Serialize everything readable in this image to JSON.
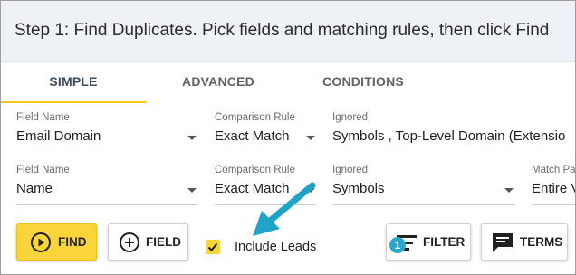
{
  "header": {
    "title": "Step 1: Find Duplicates. Pick fields and matching rules, then click Find"
  },
  "tabs": [
    {
      "label": "SIMPLE",
      "active": true
    },
    {
      "label": "ADVANCED",
      "active": false
    },
    {
      "label": "CONDITIONS",
      "active": false
    }
  ],
  "rows": [
    {
      "field": {
        "label": "Field Name",
        "value": "Email Domain"
      },
      "comparison": {
        "label": "Comparison Rule",
        "value": "Exact Match"
      },
      "ignored": {
        "label": "Ignored",
        "value": "Symbols , Top-Level Domain (Extensio"
      }
    },
    {
      "field": {
        "label": "Field Name",
        "value": "Name"
      },
      "comparison": {
        "label": "Comparison Rule",
        "value": "Exact Match"
      },
      "ignored": {
        "label": "Ignored",
        "value": "Symbols"
      },
      "match": {
        "label": "Match Pa",
        "value": "Entire V"
      }
    }
  ],
  "actions": {
    "find_label": "FIND",
    "field_label": "FIELD",
    "include_leads_label": "Include Leads",
    "include_leads_checked": true,
    "filter_label": "FILTER",
    "filter_badge": "1",
    "terms_label": "TERMS"
  },
  "colors": {
    "accent_yellow": "#f9d43a",
    "badge_blue": "#2aa8c9",
    "arrow_blue": "#1fa3c7",
    "header_bg": "#eef1f6"
  }
}
